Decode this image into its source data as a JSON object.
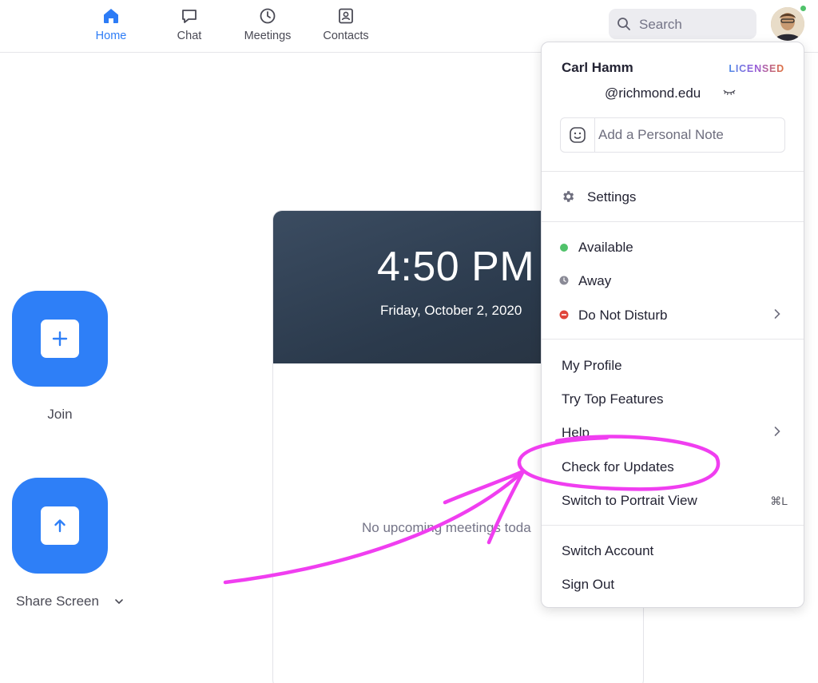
{
  "nav": {
    "tabs": [
      {
        "label": "Home",
        "icon": "home-icon",
        "active": true
      },
      {
        "label": "Chat",
        "icon": "chat-bubble-icon",
        "active": false
      },
      {
        "label": "Meetings",
        "icon": "clock-icon",
        "active": false
      },
      {
        "label": "Contacts",
        "icon": "contact-card-icon",
        "active": false
      }
    ],
    "search_placeholder": "Search",
    "accent": "#2d7cf6"
  },
  "actions": {
    "join_label": "Join",
    "share_label": "Share Screen",
    "button_color": "#2e7ff7"
  },
  "meetings": {
    "time": "4:50 PM",
    "date": "Friday, October 2, 2020",
    "empty_text": "No upcoming meetings toda"
  },
  "menu": {
    "user_name": "Carl Hamm",
    "license": "LICENSED",
    "email": "@richmond.edu",
    "note_placeholder": "Add a Personal Note",
    "settings": "Settings",
    "status": [
      {
        "label": "Available",
        "color": "#50c26a"
      },
      {
        "label": "Away",
        "color": "#8a8a96"
      },
      {
        "label": "Do Not Disturb",
        "color": "#e0453a"
      }
    ],
    "items": [
      "My Profile",
      "Try Top Features",
      "Help",
      "Check for Updates",
      "Switch to Portrait View"
    ],
    "portrait_shortcut": "⌘L",
    "account_items": [
      "Switch Account",
      "Sign Out"
    ]
  },
  "annotation": {
    "color": "#f03ef0"
  }
}
